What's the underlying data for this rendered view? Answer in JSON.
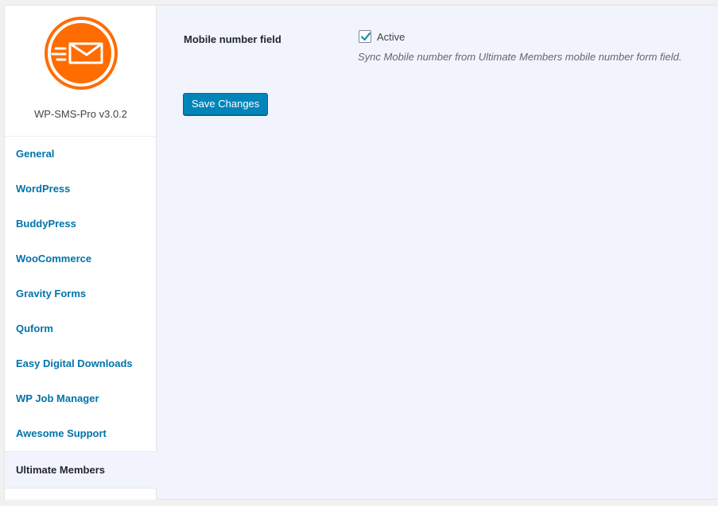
{
  "plugin": {
    "version_label": "WP-SMS-Pro v3.0.2"
  },
  "colors": {
    "logo": "#ff6c00",
    "link": "#0073aa",
    "button": "#0085ba"
  },
  "icons": {
    "logo": "envelope-icon",
    "checkbox": "checkmark-icon"
  },
  "sidebar": {
    "items": [
      {
        "label": "General"
      },
      {
        "label": "WordPress"
      },
      {
        "label": "BuddyPress"
      },
      {
        "label": "WooCommerce"
      },
      {
        "label": "Gravity Forms"
      },
      {
        "label": "Quform"
      },
      {
        "label": "Easy Digital Downloads"
      },
      {
        "label": "WP Job Manager"
      },
      {
        "label": "Awesome Support"
      },
      {
        "label": "Ultimate Members",
        "active": true
      }
    ]
  },
  "settings": {
    "field_label": "Mobile number field",
    "checkbox_label": "Active",
    "checkbox_checked": true,
    "description": "Sync Mobile number from Ultimate Members mobile number form field."
  },
  "actions": {
    "save_label": "Save Changes"
  }
}
